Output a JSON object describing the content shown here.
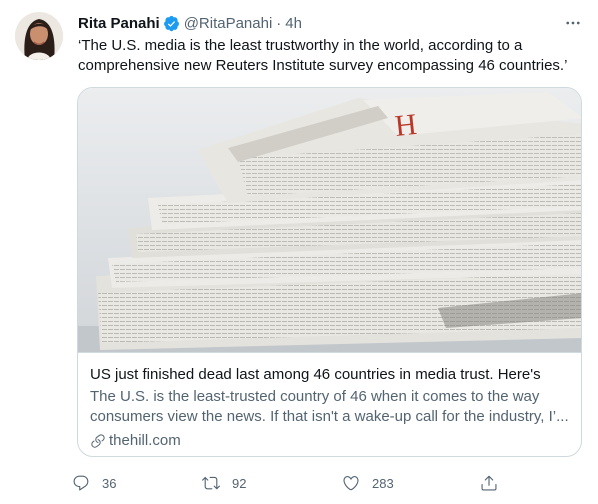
{
  "tweet": {
    "author_name": "Rita Panahi",
    "handle": "@RitaPanahi",
    "separator": "·",
    "time": "4h",
    "text": "‘The U.S. media is the least trustworthy in the world, according to a comprehensive new Reuters Institute survey encompassing 46 countries.’",
    "verified": true
  },
  "card": {
    "title": "US just finished dead last among 46 countries in media trust. Here's",
    "description": "The U.S. is the least-trusted country of 46 when it comes to the way consumers view the news. If that isn't a wake-up call for the industry, I’...",
    "domain": "thehill.com",
    "image_subject": "stack of folded newspapers"
  },
  "actions": {
    "reply_count": "36",
    "retweet_count": "92",
    "like_count": "283"
  },
  "colors": {
    "accent": "#1d9bf0",
    "text": "#0f1419",
    "secondary": "#536471",
    "border": "#cfd9de"
  },
  "icons": [
    "verified-badge-icon",
    "more-icon",
    "link-icon",
    "reply-icon",
    "retweet-icon",
    "like-icon",
    "share-icon"
  ]
}
